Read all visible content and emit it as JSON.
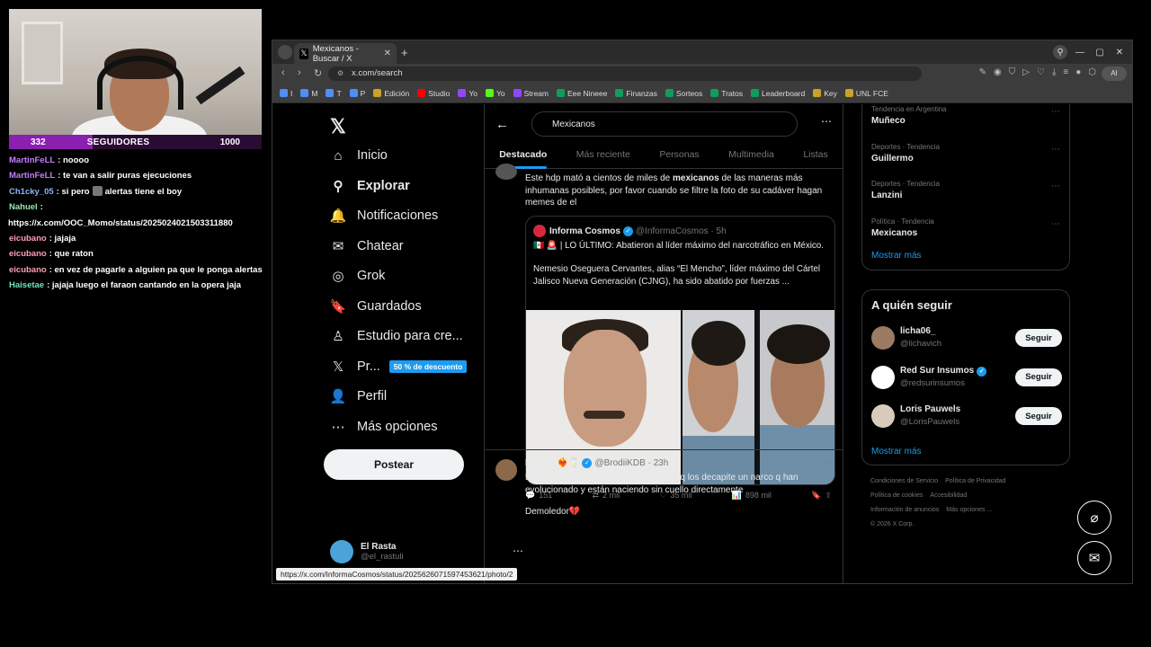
{
  "stream": {
    "followers_current": "332",
    "followers_label": "SEGUIDORES",
    "followers_goal": "1000",
    "followers_progress": 0.33,
    "chat": [
      {
        "user": "MartinFeLL",
        "color": "#c77dff",
        "text": ": noooo"
      },
      {
        "user": "MartinFeLL",
        "color": "#c77dff",
        "text": ": te van a salir puras ejecuciones"
      },
      {
        "user": "Ch1cky_05",
        "color": "#8ab4f8",
        "text": ": si pero",
        "text2": "alertas tiene el boy",
        "has_avatar": true
      },
      {
        "user": "Nahuel",
        "color": "#9ae6b4",
        "text": ":"
      },
      {
        "user": "",
        "color": "#ffffff",
        "text": "https://x.com/OOC_Momo/status/2025024021503311880"
      },
      {
        "user": "eicubano",
        "color": "#ff9db2",
        "text": ": jajaja"
      },
      {
        "user": "eicubano",
        "color": "#ff9db2",
        "text": ": que raton"
      },
      {
        "user": "eicubano",
        "color": "#ff9db2",
        "text": ": en vez de pagarle a alguien pa que le ponga alertas"
      },
      {
        "user": "Haisetae",
        "color": "#6ee7b7",
        "text": ": jajaja luego el faraon cantando en la opera jaja"
      }
    ]
  },
  "browser": {
    "tab_title": "Mexicanos - Buscar / X",
    "url": "x.com/search",
    "ai_label": "AI",
    "bookmarks": [
      {
        "label": "I",
        "color": "#4f8ef7"
      },
      {
        "label": "M",
        "color": "#4f8ef7"
      },
      {
        "label": "T",
        "color": "#4f8ef7"
      },
      {
        "label": "P",
        "color": "#4f8ef7"
      },
      {
        "label": "Edición",
        "color": "#c9a227"
      },
      {
        "label": "Studio",
        "color": "#ff0000"
      },
      {
        "label": "Yo",
        "color": "#9146ff"
      },
      {
        "label": "Yo",
        "color": "#53fc18"
      },
      {
        "label": "Stream",
        "color": "#9146ff"
      },
      {
        "label": "Eee Nineee",
        "color": "#0f9d58"
      },
      {
        "label": "Finanzas",
        "color": "#0f9d58"
      },
      {
        "label": "Sorteos",
        "color": "#0f9d58"
      },
      {
        "label": "Tratos",
        "color": "#0f9d58"
      },
      {
        "label": "Leaderboard",
        "color": "#0f9d58"
      },
      {
        "label": "Key",
        "color": "#c9a227"
      },
      {
        "label": "UNL FCE",
        "color": "#c9a227"
      }
    ]
  },
  "x": {
    "nav": [
      {
        "label": "Inicio",
        "icon": "home-icon",
        "glyph": "⌂"
      },
      {
        "label": "Explorar",
        "icon": "search-icon",
        "glyph": "⚲",
        "active": true
      },
      {
        "label": "Notificaciones",
        "icon": "bell-icon",
        "glyph": "🔔"
      },
      {
        "label": "Chatear",
        "icon": "mail-icon",
        "glyph": "✉"
      },
      {
        "label": "Grok",
        "icon": "grok-icon",
        "glyph": "◎"
      },
      {
        "label": "Guardados",
        "icon": "bookmark-icon",
        "glyph": "🔖"
      },
      {
        "label": "Estudio para cre...",
        "icon": "studio-icon",
        "glyph": "♙"
      },
      {
        "label": "Pr...",
        "icon": "x-premium-icon",
        "glyph": "𝕏"
      },
      {
        "label": "Perfil",
        "icon": "profile-icon",
        "glyph": "👤"
      },
      {
        "label": "Más opciones",
        "icon": "more-icon",
        "glyph": "⋯"
      }
    ],
    "promo_badge": "50 % de descuento",
    "post_label": "Postear",
    "account": {
      "name": "El Rasta",
      "handle": "@el_rastuli"
    },
    "search_value": "Mexicanos",
    "tabs": [
      "Destacado",
      "Más reciente",
      "Personas",
      "Multimedia",
      "Listas"
    ],
    "tweet1": {
      "text": "Este hdp mató a cientos de miles de mexicanos de las maneras más inhumanas posibles, por favor cuando se filtre la foto de su cadáver hagan memes de el",
      "quote": {
        "name": "Informa Cosmos",
        "handle": "@InformaCosmos",
        "time": "5h",
        "text1": "🇲🇽 🚨 | LO ÚLTIMO: Abatieron al líder máximo del narcotráfico en México.",
        "text2": "Nemesio Oseguera Cervantes, alias “El Mencho”, líder máximo del Cártel Jalisco Nueva Generación (CJNG), ha sido abatido por fuerzas ..."
      },
      "replies": "151",
      "reposts": "2 mil",
      "likes": "35 mil",
      "views": "898 mil"
    },
    "tweet2": {
      "name": "Brunoh❤️‍🔥🥛",
      "handle": "@BrodiiKDB",
      "time": "23h",
      "text": "Los mexicanos tienen tanto miedo de q los decapite un narco q han evolucionado y están naciendo sin cuello directamente",
      "text2": "Demoledor💔"
    },
    "status_url": "https://x.com/InformaCosmos/status/2025626071597453621/photo/2",
    "trends": [
      {
        "category": "Tendencia en Argentina",
        "name": "Muñeco"
      },
      {
        "category": "Deportes · Tendencia",
        "name": "Guillermo"
      },
      {
        "category": "Deportes · Tendencia",
        "name": "Lanzini"
      },
      {
        "category": "Política · Tendencia",
        "name": "Mexicanos"
      }
    ],
    "show_more": "Mostrar más",
    "who_title": "A quién seguir",
    "who": [
      {
        "name": "licha06_",
        "handle": "@lichavich",
        "verified": false,
        "color": "#9b7b63"
      },
      {
        "name": "Red Sur Insumos",
        "handle": "@redsurinsumos",
        "verified": true,
        "color": "#ffffff"
      },
      {
        "name": "Loris Pauwels",
        "handle": "@LorisPauwels",
        "verified": false,
        "color": "#d9cbbb"
      }
    ],
    "follow_label": "Seguir",
    "footer": [
      "Condiciones de Servicio",
      "Política de Privacidad",
      "Política de cookies",
      "Accesibilidad",
      "Información de anuncios",
      "Más opciones ...",
      "© 2026 X Corp."
    ]
  }
}
